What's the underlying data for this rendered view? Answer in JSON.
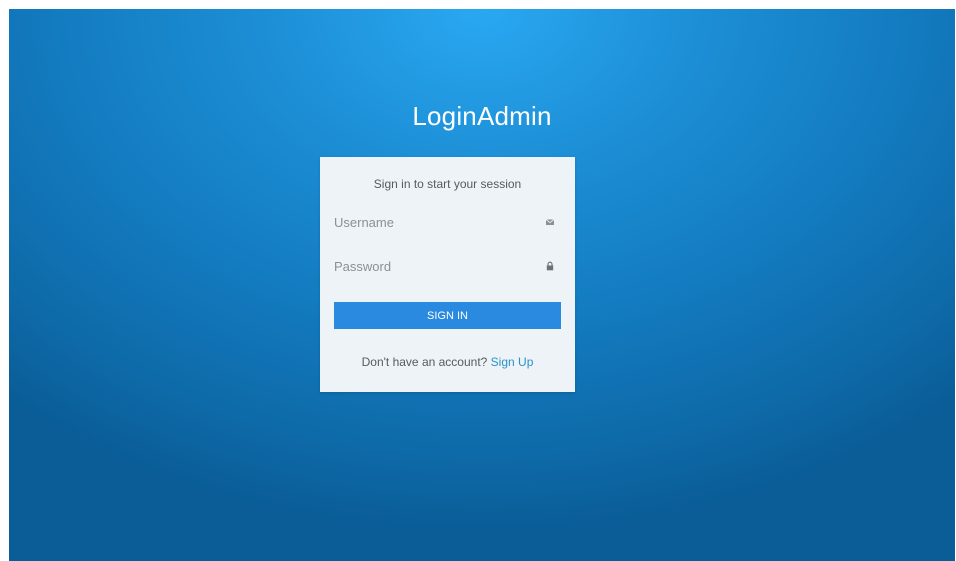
{
  "brand": {
    "title": "LoginAdmin"
  },
  "login_box": {
    "subtitle": "Sign in to start your session",
    "username": {
      "placeholder": "Username",
      "value": "",
      "icon": "envelope-icon"
    },
    "password": {
      "placeholder": "Password",
      "value": "",
      "icon": "lock-icon"
    },
    "submit_label": "SIGN IN",
    "signup_prompt": "Don't have an account?",
    "signup_link": "Sign Up"
  },
  "colors": {
    "background_light": "#29a8f2",
    "background_dark": "#0a5d97",
    "card": "#eef3f8",
    "button": "#2a8adf",
    "link": "#2a91c9"
  }
}
